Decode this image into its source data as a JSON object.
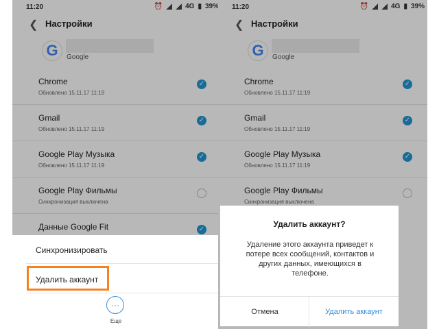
{
  "status": {
    "time": "11:20",
    "network": "4G",
    "battery": "39%"
  },
  "header": {
    "title": "Настройки",
    "provider": "Google"
  },
  "sync_items": [
    {
      "name": "Chrome",
      "status": "Обновлено 15.11.17 11:19",
      "checked": true
    },
    {
      "name": "Gmail",
      "status": "Обновлено 15.11.17 11:19",
      "checked": true
    },
    {
      "name": "Google Play Музыка",
      "status": "Обновлено 15.11.17 11:19",
      "checked": true
    },
    {
      "name": "Google Play Фильмы",
      "status": "Синхронизация выключена",
      "checked": false
    },
    {
      "name": "Данные Google Fit",
      "status": "",
      "checked": true
    }
  ],
  "sheet": {
    "sync_now": "Синхронизировать",
    "remove_account": "Удалить аккаунт",
    "more_label": "Еще"
  },
  "dialog": {
    "title": "Удалить аккаунт?",
    "message": "Удаление этого аккаунта приведет к потере всех сообщений, контактов и других данных, имеющихся в телефоне.",
    "cancel": "Отмена",
    "confirm": "Удалить аккаунт"
  },
  "colors": {
    "accent": "#2196d3",
    "highlight": "#f58220"
  }
}
